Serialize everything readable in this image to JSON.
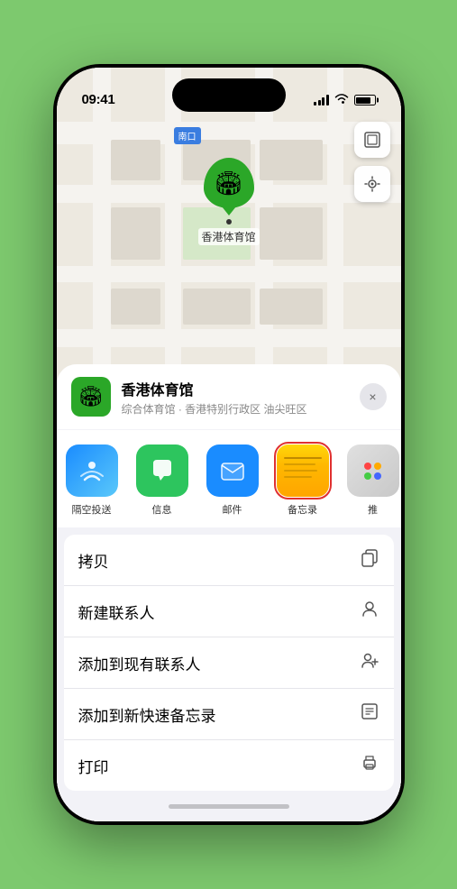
{
  "status_bar": {
    "time": "09:41",
    "location_arrow": "▶"
  },
  "map": {
    "label_text": "南口",
    "venue_pin_label": "香港体育馆"
  },
  "venue_card": {
    "name": "香港体育馆",
    "subtitle": "综合体育馆 · 香港特别行政区 油尖旺区",
    "close_label": "×"
  },
  "share_apps": [
    {
      "id": "airdrop",
      "label": "隔空投送",
      "type": "airdrop"
    },
    {
      "id": "messages",
      "label": "信息",
      "type": "messages"
    },
    {
      "id": "mail",
      "label": "邮件",
      "type": "mail"
    },
    {
      "id": "notes",
      "label": "备忘录",
      "type": "notes"
    },
    {
      "id": "more",
      "label": "推",
      "type": "more"
    }
  ],
  "menu_items": [
    {
      "id": "copy",
      "label": "拷贝",
      "icon": "copy"
    },
    {
      "id": "new-contact",
      "label": "新建联系人",
      "icon": "person"
    },
    {
      "id": "add-existing",
      "label": "添加到现有联系人",
      "icon": "person-add"
    },
    {
      "id": "add-note",
      "label": "添加到新快速备忘录",
      "icon": "note"
    },
    {
      "id": "print",
      "label": "打印",
      "icon": "printer"
    }
  ]
}
